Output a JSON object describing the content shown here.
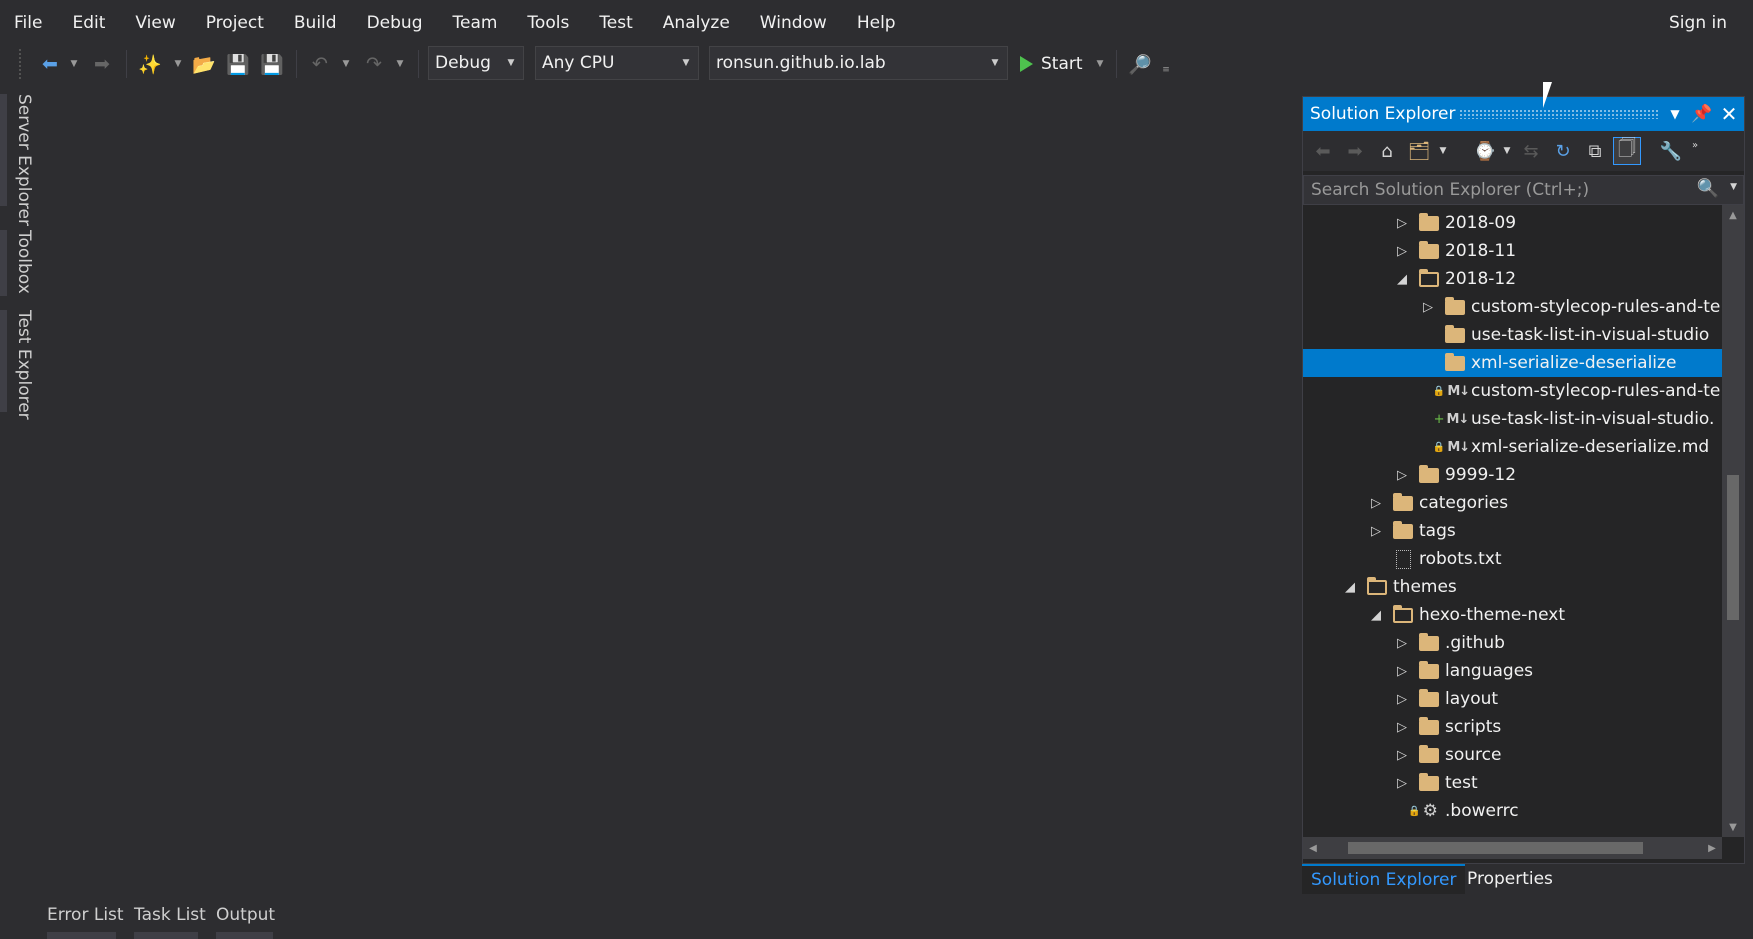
{
  "menu": {
    "items": [
      "File",
      "Edit",
      "View",
      "Project",
      "Build",
      "Debug",
      "Team",
      "Tools",
      "Test",
      "Analyze",
      "Window",
      "Help"
    ],
    "sign_in": "Sign in"
  },
  "toolbar": {
    "configuration": "Debug",
    "platform": "Any CPU",
    "startup_project": "ronsun.github.io.lab",
    "start_label": "Start"
  },
  "left_tabs": [
    "Server Explorer",
    "Toolbox",
    "Test Explorer"
  ],
  "bottom_tabs": [
    "Error List",
    "Task List",
    "Output"
  ],
  "solution_explorer": {
    "title": "Solution Explorer",
    "search_placeholder": "Search Solution Explorer (Ctrl+;)",
    "tree": [
      {
        "label": "2018-09",
        "icon": "folder",
        "indent": 3,
        "expander": "collapsed"
      },
      {
        "label": "2018-11",
        "icon": "folder",
        "indent": 3,
        "expander": "collapsed"
      },
      {
        "label": "2018-12",
        "icon": "folder-open",
        "indent": 3,
        "expander": "expanded"
      },
      {
        "label": "custom-stylecop-rules-and-te",
        "icon": "folder",
        "indent": 4,
        "expander": "collapsed"
      },
      {
        "label": "use-task-list-in-visual-studio",
        "icon": "folder",
        "indent": 4,
        "expander": "none"
      },
      {
        "label": "xml-serialize-deserialize",
        "icon": "folder",
        "indent": 4,
        "expander": "none",
        "selected": true
      },
      {
        "label": "custom-stylecop-rules-and-te",
        "icon": "markdown-locked",
        "indent": 4,
        "expander": "none"
      },
      {
        "label": "use-task-list-in-visual-studio.",
        "icon": "markdown-added",
        "indent": 4,
        "expander": "none"
      },
      {
        "label": "xml-serialize-deserialize.md",
        "icon": "markdown-locked",
        "indent": 4,
        "expander": "none"
      },
      {
        "label": "9999-12",
        "icon": "folder",
        "indent": 3,
        "expander": "collapsed"
      },
      {
        "label": "categories",
        "icon": "folder",
        "indent": 2,
        "expander": "collapsed"
      },
      {
        "label": "tags",
        "icon": "folder",
        "indent": 2,
        "expander": "collapsed"
      },
      {
        "label": "robots.txt",
        "icon": "text-file",
        "indent": 2,
        "expander": "none"
      },
      {
        "label": "themes",
        "icon": "folder-open",
        "indent": 1,
        "expander": "expanded"
      },
      {
        "label": "hexo-theme-next",
        "icon": "folder-open",
        "indent": 2,
        "expander": "expanded"
      },
      {
        "label": ".github",
        "icon": "folder",
        "indent": 3,
        "expander": "collapsed"
      },
      {
        "label": "languages",
        "icon": "folder",
        "indent": 3,
        "expander": "collapsed"
      },
      {
        "label": "layout",
        "icon": "folder",
        "indent": 3,
        "expander": "collapsed"
      },
      {
        "label": "scripts",
        "icon": "folder",
        "indent": 3,
        "expander": "collapsed"
      },
      {
        "label": "source",
        "icon": "folder",
        "indent": 3,
        "expander": "collapsed"
      },
      {
        "label": "test",
        "icon": "folder",
        "indent": 3,
        "expander": "collapsed"
      },
      {
        "label": ".bowerrc",
        "icon": "config-locked",
        "indent": 3,
        "expander": "none"
      }
    ],
    "tabs": [
      {
        "label": "Solution Explorer",
        "active": true
      },
      {
        "label": "Properties",
        "active": false
      }
    ]
  },
  "colors": {
    "background": "#2d2d30",
    "accent": "#007acc",
    "folder": "#dcb67a",
    "run": "#4ec24e"
  }
}
